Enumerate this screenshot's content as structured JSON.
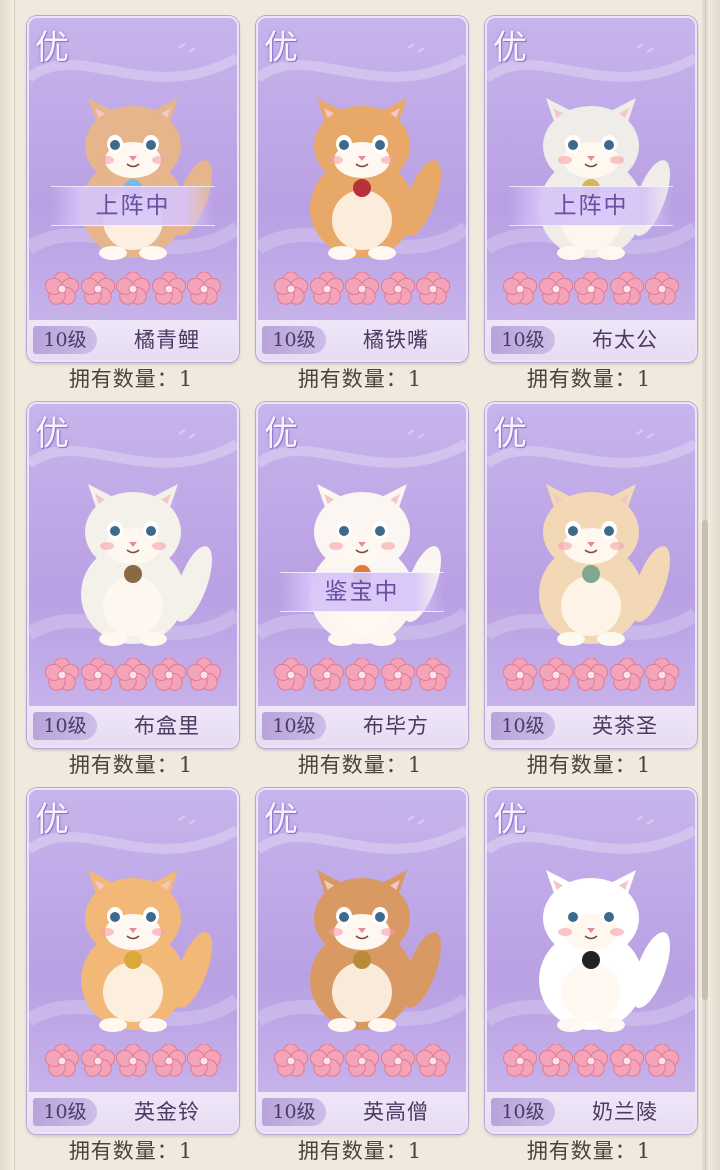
{
  "cards": [
    {
      "grade": "优",
      "level": "10级",
      "name": "橘青鲤",
      "count_label": "拥有数量：",
      "count": "1",
      "status": "上阵中",
      "stars": 5,
      "icon": "cat-koi-mermaid-icon",
      "fur": "#e6b58c",
      "accent": "#7fb7e8"
    },
    {
      "grade": "优",
      "level": "10级",
      "name": "橘铁嘴",
      "count_label": "拥有数量：",
      "count": "1",
      "status": "",
      "stars": 5,
      "icon": "cat-glasses-fan-icon",
      "fur": "#e8a868",
      "accent": "#b8303a"
    },
    {
      "grade": "优",
      "level": "10级",
      "name": "布太公",
      "count_label": "拥有数量：",
      "count": "1",
      "status": "上阵中",
      "stars": 5,
      "icon": "cat-fisherman-hat-icon",
      "fur": "#f0ece8",
      "accent": "#d9b556"
    },
    {
      "grade": "优",
      "level": "10级",
      "name": "布盒里",
      "count_label": "拥有数量：",
      "count": "1",
      "status": "",
      "stars": 5,
      "icon": "cat-in-box-icon",
      "fur": "#f4f0ea",
      "accent": "#8a6a45"
    },
    {
      "grade": "优",
      "level": "10级",
      "name": "布毕方",
      "count_label": "拥有数量：",
      "count": "1",
      "status": "鉴宝中",
      "stars": 5,
      "icon": "cat-phoenix-feather-icon",
      "fur": "#fbf6f2",
      "accent": "#e07a3a"
    },
    {
      "grade": "优",
      "level": "10级",
      "name": "英茶圣",
      "count_label": "拥有数量：",
      "count": "1",
      "status": "",
      "stars": 5,
      "icon": "cat-teapot-icon",
      "fur": "#f2d8b4",
      "accent": "#7fa890"
    },
    {
      "grade": "优",
      "level": "10级",
      "name": "英金铃",
      "count_label": "拥有数量：",
      "count": "1",
      "status": "",
      "stars": 5,
      "icon": "cat-golden-bell-icon",
      "fur": "#f1b878",
      "accent": "#d9a93a"
    },
    {
      "grade": "优",
      "level": "10级",
      "name": "英高僧",
      "count_label": "拥有数量：",
      "count": "1",
      "status": "",
      "stars": 5,
      "icon": "cat-monk-staff-icon",
      "fur": "#d89a62",
      "accent": "#b88a3a"
    },
    {
      "grade": "优",
      "level": "10级",
      "name": "奶兰陵",
      "count_label": "拥有数量：",
      "count": "1",
      "status": "",
      "stars": 5,
      "icon": "cat-mask-tuxedo-icon",
      "fur": "#ffffff",
      "accent": "#222222"
    }
  ],
  "colors": {
    "card_purple": "#b9a0e3",
    "star_pink": "#f4a4b8",
    "page_bg": "#efe9de"
  }
}
